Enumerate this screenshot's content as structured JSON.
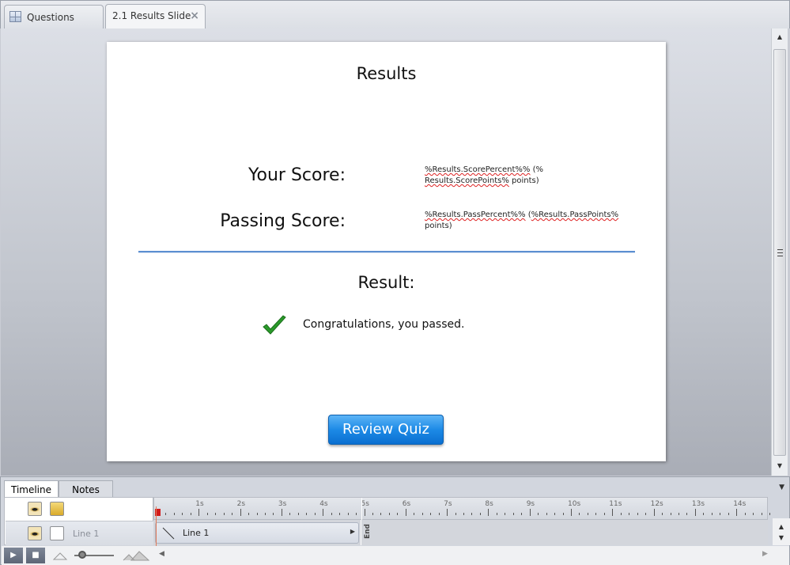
{
  "tabs": [
    {
      "label": "Questions",
      "icon": "slide-grid-icon"
    },
    {
      "label": "2.1 Results Slide",
      "close": "×"
    }
  ],
  "slide": {
    "title": "Results",
    "your_score_label": "Your Score:",
    "your_score_value_1": "%Results.ScorePercent%%",
    "your_score_value_2": " (%",
    "your_score_value_3": "Results.ScorePoints%",
    "your_score_value_4": " points)",
    "passing_score_label": "Passing Score:",
    "passing_value_1": "%Results.PassPercent%%",
    "passing_value_2": " (",
    "passing_value_3": "%Results.PassPoints%",
    "passing_value_4": " points)",
    "result_label": "Result:",
    "message": "Congratulations, you passed.",
    "review_button": "Review Quiz",
    "accent": "#1d8ae6"
  },
  "timeline": {
    "tabs": [
      "Timeline",
      "Notes"
    ],
    "layer_name": "Line 1",
    "object_name": "Line 1",
    "end_label": "End",
    "ruler": [
      "1s",
      "2s",
      "3s",
      "4s",
      "5s",
      "6s",
      "7s",
      "8s",
      "9s",
      "10s",
      "11s",
      "12s",
      "13s",
      "14s"
    ]
  }
}
